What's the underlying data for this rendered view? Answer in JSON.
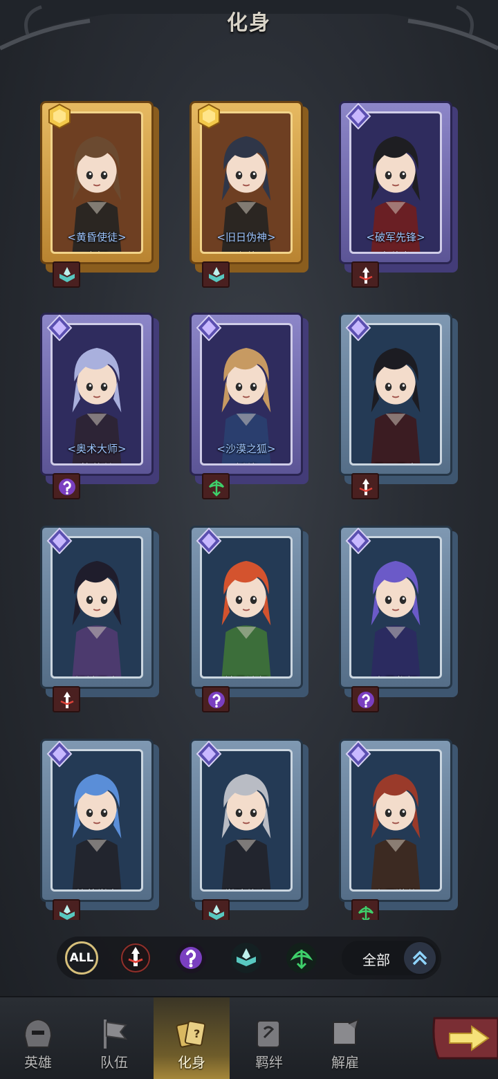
{
  "header": {
    "title": "化身"
  },
  "cards": [
    {
      "name": "安娜",
      "epithet": "<黄昏使徒>",
      "rarity": "gold",
      "hair": "#6b4a30",
      "outfit": "#2b2622",
      "gem_icon": "gold-hex-gem-icon",
      "class_icon": "arcane-book-icon"
    },
    {
      "name": "海伦",
      "epithet": "<旧日伪神>",
      "rarity": "gold",
      "hair": "#2f3648",
      "outfit": "#2b2622",
      "gem_icon": "gold-hex-gem-icon",
      "class_icon": "arcane-book-icon"
    },
    {
      "name": "奥伯龙",
      "epithet": "<破军先锋>",
      "rarity": "purple",
      "hair": "#1e1e22",
      "outfit": "#6a1f24",
      "gem_icon": "purple-diamond-gem-icon",
      "class_icon": "warrior-sword-icon"
    },
    {
      "name": "格蕾丝",
      "epithet": "<奥术大师>",
      "rarity": "purple",
      "hair": "#a9b0dd",
      "outfit": "#2d2436",
      "gem_icon": "purple-diamond-gem-icon",
      "class_icon": "mage-orb-icon"
    },
    {
      "name": "托德",
      "epithet": "<沙漠之狐>",
      "rarity": "purple",
      "hair": "#c79a62",
      "outfit": "#2a3e6e",
      "gem_icon": "purple-diamond-gem-icon",
      "class_icon": "ranger-bow-icon"
    },
    {
      "name": "黑石勇士",
      "epithet": "",
      "rarity": "blue",
      "hair": "#1c1c22",
      "outfit": "#3b1c22",
      "gem_icon": "purple-diamond-gem-icon",
      "class_icon": "warrior-sword-icon"
    },
    {
      "name": "钢铁卫士",
      "epithet": "",
      "rarity": "blue",
      "hair": "#1f1d2c",
      "outfit": "#4c3a6e",
      "gem_icon": "purple-diamond-gem-icon",
      "class_icon": "warrior-sword-icon"
    },
    {
      "name": "精灵法师",
      "epithet": "",
      "rarity": "blue",
      "hair": "#d4532e",
      "outfit": "#3c6e3a",
      "gem_icon": "purple-diamond-gem-icon",
      "class_icon": "mage-orb-icon"
    },
    {
      "name": "木灵祭祀",
      "epithet": "",
      "rarity": "blue",
      "hair": "#6b5ac8",
      "outfit": "#2b2b60",
      "gem_icon": "purple-diamond-gem-icon",
      "class_icon": "mage-orb-icon"
    },
    {
      "name": "苍蓝学者",
      "epithet": "",
      "rarity": "blue",
      "hair": "#5a8ed8",
      "outfit": "#22252e",
      "gem_icon": "purple-diamond-gem-icon",
      "class_icon": "arcane-book-icon"
    },
    {
      "name": "学院修士",
      "epithet": "",
      "rarity": "blue",
      "hair": "#b9bcc4",
      "outfit": "#22252e",
      "gem_icon": "purple-diamond-gem-icon",
      "class_icon": "arcane-book-icon"
    },
    {
      "name": "尘风游侠",
      "epithet": "",
      "rarity": "blue",
      "hair": "#9a3a2a",
      "outfit": "#3c2a22",
      "gem_icon": "purple-diamond-gem-icon",
      "class_icon": "ranger-bow-icon"
    }
  ],
  "filters": {
    "all_label": "ALL",
    "buttons": [
      {
        "name": "warrior-filter",
        "icon": "warrior-sword-icon",
        "color": "#e0433a"
      },
      {
        "name": "mage-filter",
        "icon": "mage-orb-icon",
        "color": "#a35ce0"
      },
      {
        "name": "arcane-filter",
        "icon": "arcane-book-icon",
        "color": "#58c8c0"
      },
      {
        "name": "ranger-filter",
        "icon": "ranger-bow-icon",
        "color": "#3ecf6a"
      }
    ],
    "sort_label": "全部"
  },
  "nav": [
    {
      "label": "英雄",
      "icon": "helmet-icon",
      "active": false
    },
    {
      "label": "队伍",
      "icon": "flag-icon",
      "active": false
    },
    {
      "label": "化身",
      "icon": "cards-icon",
      "active": true
    },
    {
      "label": "羁绊",
      "icon": "scroll-icon",
      "active": false
    },
    {
      "label": "解雇",
      "icon": "dismiss-icon",
      "active": false
    }
  ],
  "colors": {
    "epithet": "#9fc6ff",
    "gold_frame": "#e6b961",
    "purple_frame": "#8c86c8",
    "blue_frame": "#7f98b2",
    "active_nav": "#a8893a"
  }
}
